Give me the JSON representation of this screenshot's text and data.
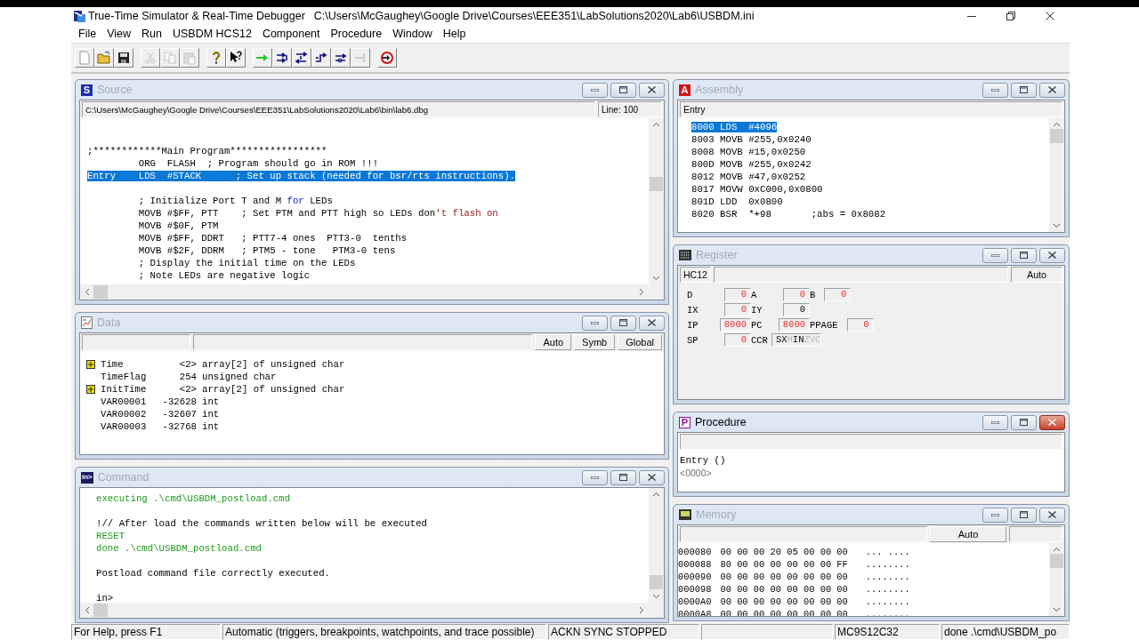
{
  "window": {
    "title": "True-Time Simulator & Real-Time Debugger",
    "path": "C:\\Users\\McGaughey\\Google Drive\\Courses\\EEE351\\LabSolutions2020\\Lab6\\USBDM.ini"
  },
  "menu": [
    "File",
    "View",
    "Run",
    "USBDM HCS12",
    "Component",
    "Procedure",
    "Window",
    "Help"
  ],
  "toolbar": [
    [
      {
        "kind": "new",
        "disabled": false
      },
      {
        "kind": "open",
        "disabled": false
      },
      {
        "kind": "save",
        "disabled": false
      }
    ],
    [
      {
        "kind": "cut",
        "disabled": true
      },
      {
        "kind": "copy",
        "disabled": true
      },
      {
        "kind": "paste",
        "disabled": true
      }
    ],
    [
      {
        "kind": "help",
        "disabled": false
      },
      {
        "kind": "context_help",
        "disabled": false
      }
    ],
    [
      {
        "kind": "go",
        "disabled": false
      },
      {
        "kind": "step_in",
        "disabled": false
      },
      {
        "kind": "step_over",
        "disabled": false
      },
      {
        "kind": "step_out",
        "disabled": false
      },
      {
        "kind": "asm_step",
        "disabled": false
      },
      {
        "kind": "halt",
        "disabled": true
      }
    ],
    [
      {
        "kind": "reset",
        "disabled": false
      }
    ]
  ],
  "panes": [
    {
      "kind": "source",
      "badge": "S",
      "title": "Source",
      "active": false,
      "path": "C:\\Users\\McGaughey\\Google Drive\\Courses\\EEE351\\LabSolutions2020\\Lab6\\bin\\lab6.dbg",
      "line": "Line: 100",
      "lines": [
        {
          "kind": "blank"
        },
        {
          "kind": "blank"
        },
        {
          "kind": "code",
          "selected": false,
          "segments": [
            {
              "kind": "plain",
              "text": ";************Main Program*****************"
            }
          ]
        },
        {
          "kind": "code",
          "selected": false,
          "segments": [
            {
              "kind": "plain",
              "text": "         ORG  FLASH  ; Program should go in ROM !!!"
            }
          ]
        },
        {
          "kind": "code",
          "selected": true,
          "segments": [
            {
              "kind": "plain",
              "text": "Entry    LDS  #STACK      ; Set up stack (needed for bsr/rts instructions)."
            }
          ]
        },
        {
          "kind": "blank"
        },
        {
          "kind": "code",
          "selected": false,
          "segments": [
            {
              "kind": "plain",
              "text": "         ; Initialize Port T and M "
            },
            {
              "kind": "keyword",
              "text": "for"
            },
            {
              "kind": "plain",
              "text": " LEDs"
            }
          ]
        },
        {
          "kind": "code",
          "selected": false,
          "segments": [
            {
              "kind": "plain",
              "text": "         MOVB #$FF, PTT    ; Set PTM and PTT high so LEDs don"
            },
            {
              "kind": "string",
              "text": "'t flash on"
            }
          ]
        },
        {
          "kind": "code",
          "selected": false,
          "segments": [
            {
              "kind": "plain",
              "text": "         MOVB #$0F, PTM"
            }
          ]
        },
        {
          "kind": "code",
          "selected": false,
          "segments": [
            {
              "kind": "plain",
              "text": "         MOVB #$FF, DDRT   ; PTT7-4 ones  PTT3-0  tenths"
            }
          ]
        },
        {
          "kind": "code",
          "selected": false,
          "segments": [
            {
              "kind": "plain",
              "text": "         MOVB #$2F, DDRM   ; PTM5 - tone   PTM3-0 tens"
            }
          ]
        },
        {
          "kind": "code",
          "selected": false,
          "segments": [
            {
              "kind": "plain",
              "text": "         ; Display the initial time on the LEDs"
            }
          ]
        },
        {
          "kind": "code",
          "selected": false,
          "segments": [
            {
              "kind": "plain",
              "text": "         ; Note LEDs are negative logic"
            }
          ]
        }
      ]
    },
    {
      "kind": "data",
      "title": "Data",
      "active": false,
      "buttons": [
        "Auto",
        "Symb",
        "Global"
      ],
      "rows": [
        {
          "name": "Time",
          "value": "<2>",
          "type": "array[2] of unsigned char",
          "expandable": true
        },
        {
          "name": "TimeFlag",
          "value": "254",
          "type": "unsigned char",
          "expandable": false
        },
        {
          "name": "InitTime",
          "value": "<2>",
          "type": "array[2] of unsigned char",
          "expandable": true
        },
        {
          "name": "VAR00001",
          "value": "-32628",
          "type": "int",
          "expandable": false
        },
        {
          "name": "VAR00002",
          "value": "-32607",
          "type": "int",
          "expandable": false
        },
        {
          "name": "VAR00003",
          "value": "-32768",
          "type": "int",
          "expandable": false
        }
      ]
    },
    {
      "kind": "command",
      "badge": "in>",
      "title": "Command",
      "active": false,
      "lines": [
        {
          "kind": "echo",
          "text": "executing .\\cmd\\USBDM_postload.cmd"
        },
        {
          "kind": "blank"
        },
        {
          "kind": "output",
          "text": "!// After load the commands written below will be executed"
        },
        {
          "kind": "echo",
          "text": "RESET"
        },
        {
          "kind": "echo",
          "text": "done .\\cmd\\USBDM_postload.cmd"
        },
        {
          "kind": "blank"
        },
        {
          "kind": "output",
          "text": "Postload command file correctly executed."
        },
        {
          "kind": "blank"
        },
        {
          "kind": "output",
          "text": "in>"
        }
      ]
    },
    {
      "kind": "assembly",
      "badge": "A",
      "title": "Assembly",
      "active": false,
      "header": "Entry",
      "lines": [
        {
          "text": "8000 LDS  #4096",
          "selected": true
        },
        {
          "text": "8003 MOVB #255,0x0240",
          "selected": false
        },
        {
          "text": "8008 MOVB #15,0x0250",
          "selected": false
        },
        {
          "text": "800D MOVB #255,0x0242",
          "selected": false
        },
        {
          "text": "8012 MOVB #47,0x0252",
          "selected": false
        },
        {
          "text": "8017 MOVW 0xC000,0x0800",
          "selected": false
        },
        {
          "text": "801D LDD  0x0800",
          "selected": false
        },
        {
          "text": "8020 BSR  *+98       ;abs = 0x8082",
          "selected": false
        }
      ]
    },
    {
      "kind": "register",
      "title": "Register",
      "active": false,
      "cpu": "HC12",
      "mode": "Auto",
      "rows": [
        [
          {
            "kind": "value",
            "label": "D",
            "value": "0",
            "changed": true
          },
          {
            "kind": "value",
            "label": "A",
            "value": "0",
            "changed": true
          },
          {
            "kind": "value",
            "label": "B",
            "value": "0",
            "changed": true
          }
        ],
        [
          {
            "kind": "value",
            "label": "IX",
            "value": "0",
            "changed": true
          },
          {
            "kind": "value",
            "label": "IY",
            "value": "0",
            "changed": false
          }
        ],
        [
          {
            "kind": "value",
            "label": "IP",
            "value": "8000",
            "changed": true
          },
          {
            "kind": "value",
            "label": "PC",
            "value": "8000",
            "changed": true
          },
          {
            "kind": "value",
            "label": "PPAGE",
            "value": "0",
            "changed": true
          }
        ],
        [
          {
            "kind": "value",
            "label": "SP",
            "value": "0",
            "changed": true
          },
          {
            "kind": "flags",
            "label": "CCR",
            "flags": [
              {
                "letter": "S",
                "set": true
              },
              {
                "letter": "X",
                "set": true
              },
              {
                "letter": "H",
                "set": false
              },
              {
                "letter": "I",
                "set": true
              },
              {
                "letter": "N",
                "set": true
              },
              {
                "letter": "Z",
                "set": false
              },
              {
                "letter": "V",
                "set": false
              },
              {
                "letter": "C",
                "set": false
              }
            ]
          }
        ]
      ]
    },
    {
      "kind": "procedure",
      "badge": "P",
      "title": "Procedure",
      "active": true,
      "lines": [
        {
          "kind": "frame",
          "text": "Entry ()"
        },
        {
          "kind": "address",
          "text": "<0000>"
        }
      ]
    },
    {
      "kind": "memory",
      "title": "Memory",
      "active": false,
      "mode": "Auto",
      "rows": [
        {
          "address": "000080",
          "bytes": "00 00 00 20 05 00 00 00",
          "ascii": "... ...."
        },
        {
          "address": "000088",
          "bytes": "80 00 00 00 00 00 00 FF",
          "ascii": "........"
        },
        {
          "address": "000090",
          "bytes": "00 00 00 00 00 00 00 00",
          "ascii": "........"
        },
        {
          "address": "000098",
          "bytes": "00 00 00 00 00 00 00 00",
          "ascii": "........"
        },
        {
          "address": "0000A0",
          "bytes": "00 00 00 00 00 00 00 00",
          "ascii": "........"
        },
        {
          "address": "0000A8",
          "bytes": "00 00 00 00 00 00 00 00",
          "ascii": "........"
        }
      ]
    }
  ],
  "status_bar": [
    "For Help, press F1",
    "Automatic (triggers, breakpoints, watchpoints, and trace possible)",
    "ACKN SYNC STOPPED",
    "MC9S12C32",
    "done .\\cmd\\USBDM_po"
  ]
}
